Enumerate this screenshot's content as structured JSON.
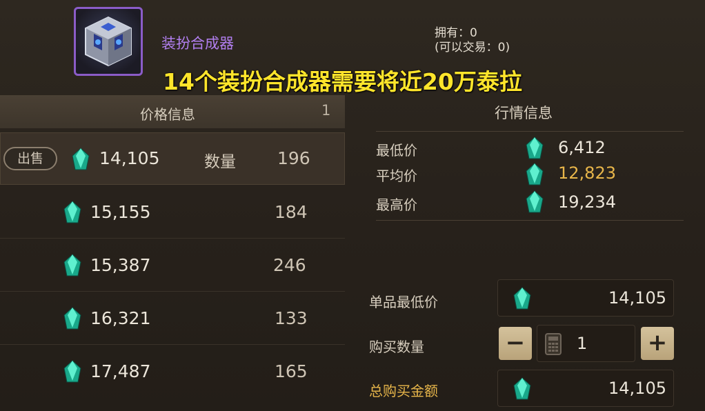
{
  "item": {
    "icon": "costume-synthesizer-cube-icon",
    "name": "装扮合成器",
    "owned_label": "拥有：0",
    "tradable_label": "(可以交易：0)"
  },
  "banner": "14个装扮合成器需要将近20万泰拉",
  "price_panel": {
    "title": "价格信息",
    "page": "1",
    "sell_label": "出售",
    "quantity_label": "数量",
    "rows": [
      {
        "price": "14,105",
        "qty": "196"
      },
      {
        "price": "15,155",
        "qty": "184"
      },
      {
        "price": "15,387",
        "qty": "246"
      },
      {
        "price": "16,321",
        "qty": "133"
      },
      {
        "price": "17,487",
        "qty": "165"
      }
    ]
  },
  "market_panel": {
    "title": "行情信息",
    "min_label": "最低价",
    "min_value": "6,412",
    "avg_label": "平均价",
    "avg_value": "12,823",
    "max_label": "最高价",
    "max_value": "19,234"
  },
  "purchase": {
    "unit_min_label": "单品最低价",
    "unit_min_value": "14,105",
    "buy_qty_label": "购买数量",
    "minus": "−",
    "plus": "+",
    "qty_value": "1",
    "total_label": "总购买金额",
    "total_value": "14,105"
  },
  "colors": {
    "banner": "#ffe52b",
    "item_name": "#b27ff0",
    "average": "#e8b64a",
    "gem": "#2fd6b0"
  }
}
